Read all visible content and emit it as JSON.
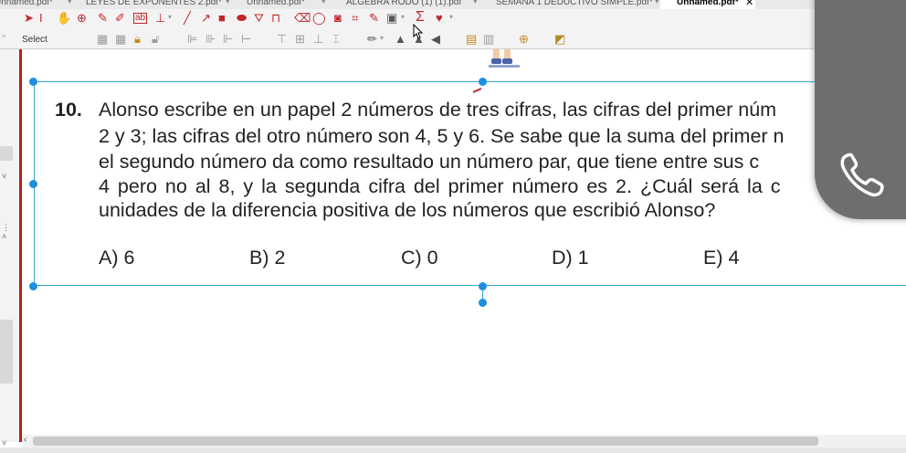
{
  "tabs": [
    {
      "label": "Unnamed.pdf*",
      "active": false
    },
    {
      "label": "LEYES DE EXPONENTES 2.pdf*",
      "active": false
    },
    {
      "label": "Unnamed.pdf*",
      "active": false
    },
    {
      "label": "ALGEBRA RODO (1) (1).pdf",
      "active": false
    },
    {
      "label": "SEMANA 1 DEDUCTIVO SIMPLE.pdf*",
      "active": false
    },
    {
      "label": "Unnamed.pdf*",
      "active": true
    }
  ],
  "toolbar": {
    "select_label": "Select"
  },
  "question": {
    "number": "10.",
    "lines": [
      "Alonso escribe en un papel 2 números de tres cifras, las cifras del primer núm",
      "2 y 3; las cifras del otro número son 4, 5 y 6. Se sabe que la suma del primer n",
      "el segundo número da como resultado un número par, que tiene entre sus c",
      "4 pero no al 8, y la segunda cifra del primer número es 2. ¿Cuál será la c",
      "unidades de la diferencia positiva de los números que escribió Alonso?"
    ]
  },
  "options": [
    {
      "label": "A) 6"
    },
    {
      "label": "B) 2"
    },
    {
      "label": "C) 0"
    },
    {
      "label": "D) 1"
    },
    {
      "label": "E) 4"
    }
  ],
  "colors": {
    "selection": "#35a8d6",
    "handle": "#1e8fe0",
    "accent_red": "#b5201b",
    "overlay": "#6e6e6e"
  },
  "icons": [
    "select-arrow-icon",
    "pan-icon",
    "zoom-icon",
    "pen-icon",
    "highlight-icon",
    "line-icon",
    "arrow-icon",
    "rectangle-icon",
    "ellipse-icon",
    "note-icon",
    "stamp-icon",
    "link-icon",
    "camera-icon",
    "crop-icon",
    "sigma-icon",
    "heart-icon",
    "phone-icon"
  ]
}
